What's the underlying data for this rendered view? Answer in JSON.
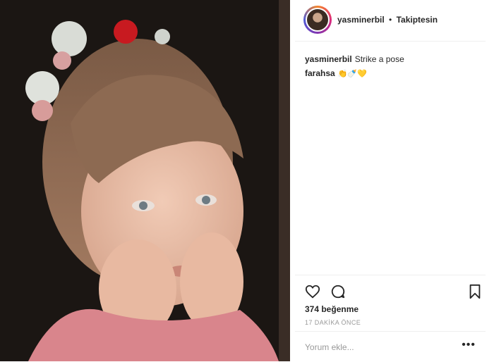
{
  "post": {
    "username": "yasminerbil",
    "separator": "•",
    "follow_status": "Takiptesin",
    "caption": "Strike a pose",
    "comments": [
      {
        "user": "farahsa",
        "text": "👏🍼💛"
      }
    ],
    "likes": "374 beğenme",
    "time_ago": "17 DAKİKA ÖNCE",
    "comment_placeholder": "Yorum ekle...",
    "more_label": "•••"
  },
  "icons": {
    "like": "heart-icon",
    "comment": "comment-bubble-icon",
    "save": "bookmark-icon"
  }
}
